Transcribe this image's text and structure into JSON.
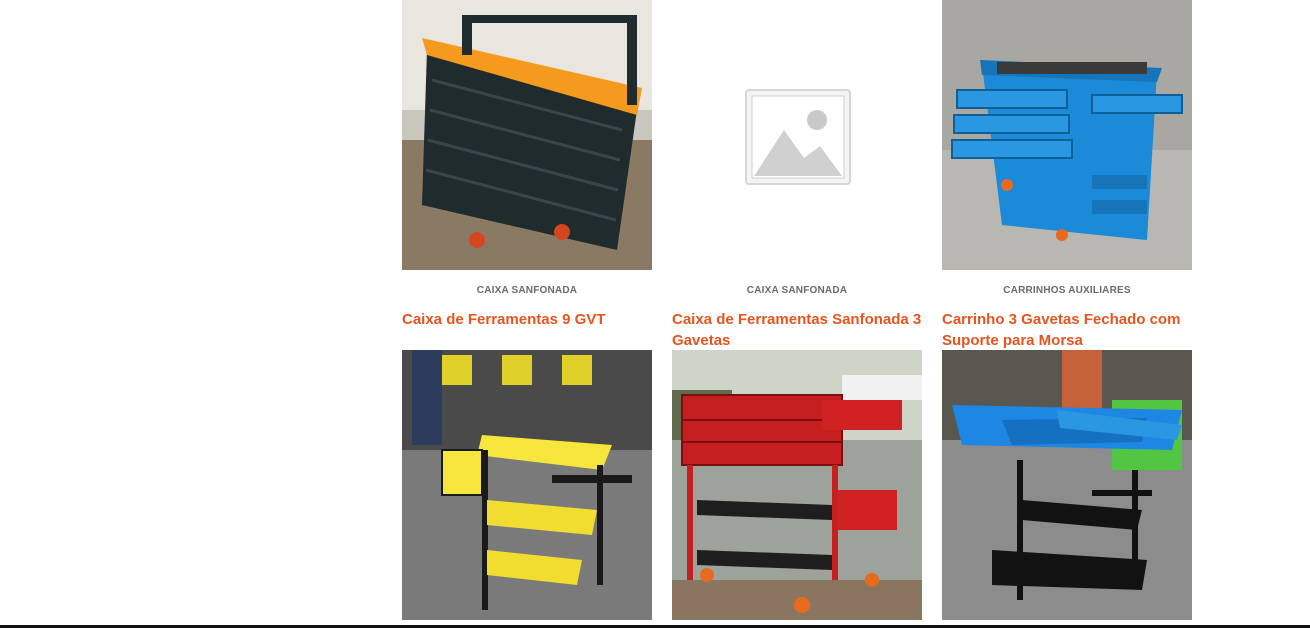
{
  "products": [
    {
      "category": "CAIXA SANFONADA",
      "title": "Caixa de Ferramentas 9 GVT",
      "image": "orange-black-accordion-toolbox-photo"
    },
    {
      "category": "CAIXA SANFONADA",
      "title": "Caixa de Ferramentas Sanfonada 3 Gavetas",
      "image": "placeholder-image-icon"
    },
    {
      "category": "CARRINHOS AUXILIARES",
      "title": "Carrinho 3 Gavetas Fechado com Suporte para Morsa",
      "image": "blue-drawer-cart-photo"
    },
    {
      "image": "yellow-black-cart-photo"
    },
    {
      "image": "red-drawer-cart-photo"
    },
    {
      "image": "blue-black-toolbox-cart-photo"
    }
  ],
  "colors": {
    "title": "#e6551f",
    "category": "#6b6b6b"
  }
}
